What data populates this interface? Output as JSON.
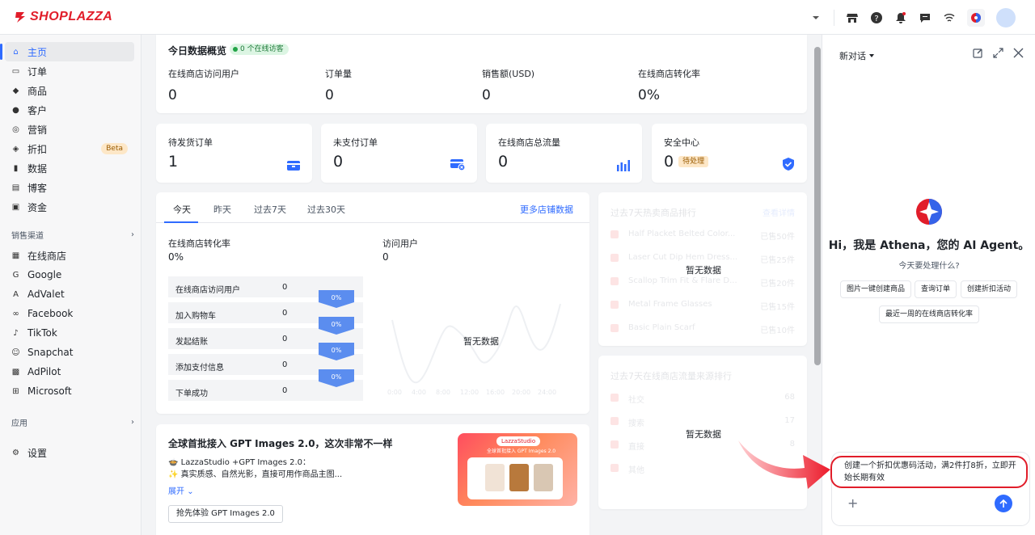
{
  "brand": {
    "logo_text": "SHOPLAZZA",
    "accent": "#2f6bff",
    "brand_red": "#e11d2a"
  },
  "topbar": {
    "icons": [
      "chevron-down-icon",
      "store-icon",
      "help-icon",
      "bell-icon",
      "message-icon",
      "wifi-icon",
      "athena-app-icon",
      "user-avatar"
    ]
  },
  "sidebar": {
    "items": [
      {
        "label": "主页",
        "icon": "home-icon",
        "active": true
      },
      {
        "label": "订单",
        "icon": "inbox-icon"
      },
      {
        "label": "商品",
        "icon": "tag-icon"
      },
      {
        "label": "客户",
        "icon": "person-icon"
      },
      {
        "label": "营销",
        "icon": "megaphone-icon"
      },
      {
        "label": "折扣",
        "icon": "discount-icon",
        "badge": "Beta"
      },
      {
        "label": "数据",
        "icon": "bar-chart-icon"
      },
      {
        "label": "博客",
        "icon": "blog-icon"
      },
      {
        "label": "资金",
        "icon": "wallet-icon"
      }
    ],
    "channels_title": "销售渠道",
    "channels": [
      {
        "label": "在线商店",
        "icon": "store-icon"
      },
      {
        "label": "Google",
        "icon": "google-icon"
      },
      {
        "label": "AdValet",
        "icon": "advalet-icon"
      },
      {
        "label": "Facebook",
        "icon": "facebook-icon"
      },
      {
        "label": "TikTok",
        "icon": "tiktok-icon"
      },
      {
        "label": "Snapchat",
        "icon": "snapchat-icon"
      },
      {
        "label": "AdPilot",
        "icon": "adpilot-icon"
      },
      {
        "label": "Microsoft",
        "icon": "microsoft-icon"
      }
    ],
    "apps_title": "应用",
    "settings_label": "设置"
  },
  "today": {
    "title": "今日数据概览",
    "online_visitors": "0 个在线访客",
    "kpis": [
      {
        "label": "在线商店访问用户",
        "value": "0"
      },
      {
        "label": "订单量",
        "value": "0"
      },
      {
        "label": "销售额(USD)",
        "value": "0"
      },
      {
        "label": "在线商店转化率",
        "value": "0%"
      }
    ]
  },
  "mini_cards": [
    {
      "label": "待发货订单",
      "value": "1",
      "icon": "shipping-box-icon"
    },
    {
      "label": "未支付订单",
      "value": "0",
      "icon": "unpaid-card-icon"
    },
    {
      "label": "在线商店总流量",
      "value": "0",
      "icon": "traffic-bars-icon"
    },
    {
      "label": "安全中心",
      "value": "0",
      "badge": "待处理",
      "icon": "shield-check-icon"
    }
  ],
  "analytics": {
    "tabs": [
      "今天",
      "昨天",
      "过去7天",
      "过去30天"
    ],
    "more_link": "更多店铺数据",
    "conversion_label": "在线商店转化率",
    "conversion_value": "0%",
    "visitors_label": "访问用户",
    "visitors_value": "0",
    "funnel": [
      {
        "label": "在线商店访问用户",
        "value": "0"
      },
      {
        "label": "加入购物车",
        "value": "0"
      },
      {
        "label": "发起结账",
        "value": "0"
      },
      {
        "label": "添加支付信息",
        "value": "0"
      },
      {
        "label": "下单成功",
        "value": "0"
      }
    ],
    "funnel_rates": [
      "0%",
      "0%",
      "0%",
      "0%"
    ],
    "no_data": "暂无数据",
    "x_ticks": [
      "0:00",
      "4:00",
      "8:00",
      "12:00",
      "16:00",
      "20:00",
      "24:00"
    ]
  },
  "hot_products": {
    "title": "过去7天热卖商品排行",
    "link": "查看详情",
    "rows": [
      {
        "name": "Half Placket Belted Color...",
        "sold": "已售50件"
      },
      {
        "name": "Laser Cut Dip Hem Dress...",
        "sold": "已售25件"
      },
      {
        "name": "Scallop Trim Fit & Flare D...",
        "sold": "已售20件"
      },
      {
        "name": "Metal Frame Glasses",
        "sold": "已售15件"
      },
      {
        "name": "Basic Plain Scarf",
        "sold": "已售10件"
      }
    ],
    "no_data": "暂无数据"
  },
  "traffic_sources": {
    "title": "过去7天在线商店流量来源排行",
    "rows": [
      {
        "name": "社交",
        "value": "68"
      },
      {
        "name": "搜索",
        "value": "17"
      },
      {
        "name": "直接",
        "value": "8"
      },
      {
        "name": "其他",
        "value": ""
      }
    ],
    "no_data": "暂无数据"
  },
  "promo": {
    "title": "全球首批接入 GPT Images 2.0，这次非常不一样",
    "line1": "🍲 LazzaStudio +GPT Images 2.0：",
    "line2": "✨ 真实质感、自然光影，直接可用作商品主图...",
    "expand": "展开",
    "button": "抢先体验 GPT Images 2.0",
    "image_brand": "LazzaStudio",
    "image_caption": "全球首批接入 GPT Images 2.0"
  },
  "assistant": {
    "new_chat": "新对话",
    "greeting": "Hi，我是 Athena，您的 AI Agent。",
    "subtitle": "今天要处理什么?",
    "suggestions": [
      "图片一键创建商品",
      "查询订单",
      "创建折扣活动",
      "最近一周的在线商店转化率"
    ],
    "input_text": "创建一个折扣优惠码活动，满2件打8折，立即开始长期有效",
    "tools": [
      "edit-icon",
      "expand-icon",
      "close-icon"
    ]
  }
}
